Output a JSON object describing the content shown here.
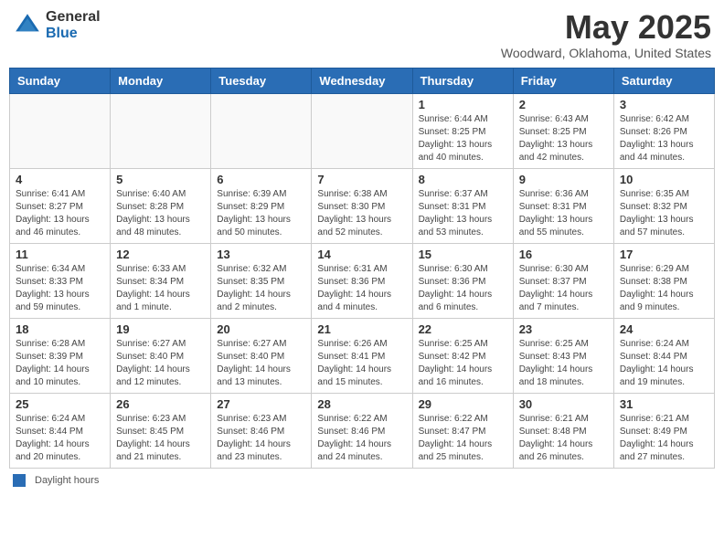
{
  "header": {
    "logo_general": "General",
    "logo_blue": "Blue",
    "month_title": "May 2025",
    "location": "Woodward, Oklahoma, United States"
  },
  "days_of_week": [
    "Sunday",
    "Monday",
    "Tuesday",
    "Wednesday",
    "Thursday",
    "Friday",
    "Saturday"
  ],
  "weeks": [
    [
      {
        "day": "",
        "info": ""
      },
      {
        "day": "",
        "info": ""
      },
      {
        "day": "",
        "info": ""
      },
      {
        "day": "",
        "info": ""
      },
      {
        "day": "1",
        "info": "Sunrise: 6:44 AM\nSunset: 8:25 PM\nDaylight: 13 hours and 40 minutes."
      },
      {
        "day": "2",
        "info": "Sunrise: 6:43 AM\nSunset: 8:25 PM\nDaylight: 13 hours and 42 minutes."
      },
      {
        "day": "3",
        "info": "Sunrise: 6:42 AM\nSunset: 8:26 PM\nDaylight: 13 hours and 44 minutes."
      }
    ],
    [
      {
        "day": "4",
        "info": "Sunrise: 6:41 AM\nSunset: 8:27 PM\nDaylight: 13 hours and 46 minutes."
      },
      {
        "day": "5",
        "info": "Sunrise: 6:40 AM\nSunset: 8:28 PM\nDaylight: 13 hours and 48 minutes."
      },
      {
        "day": "6",
        "info": "Sunrise: 6:39 AM\nSunset: 8:29 PM\nDaylight: 13 hours and 50 minutes."
      },
      {
        "day": "7",
        "info": "Sunrise: 6:38 AM\nSunset: 8:30 PM\nDaylight: 13 hours and 52 minutes."
      },
      {
        "day": "8",
        "info": "Sunrise: 6:37 AM\nSunset: 8:31 PM\nDaylight: 13 hours and 53 minutes."
      },
      {
        "day": "9",
        "info": "Sunrise: 6:36 AM\nSunset: 8:31 PM\nDaylight: 13 hours and 55 minutes."
      },
      {
        "day": "10",
        "info": "Sunrise: 6:35 AM\nSunset: 8:32 PM\nDaylight: 13 hours and 57 minutes."
      }
    ],
    [
      {
        "day": "11",
        "info": "Sunrise: 6:34 AM\nSunset: 8:33 PM\nDaylight: 13 hours and 59 minutes."
      },
      {
        "day": "12",
        "info": "Sunrise: 6:33 AM\nSunset: 8:34 PM\nDaylight: 14 hours and 1 minute."
      },
      {
        "day": "13",
        "info": "Sunrise: 6:32 AM\nSunset: 8:35 PM\nDaylight: 14 hours and 2 minutes."
      },
      {
        "day": "14",
        "info": "Sunrise: 6:31 AM\nSunset: 8:36 PM\nDaylight: 14 hours and 4 minutes."
      },
      {
        "day": "15",
        "info": "Sunrise: 6:30 AM\nSunset: 8:36 PM\nDaylight: 14 hours and 6 minutes."
      },
      {
        "day": "16",
        "info": "Sunrise: 6:30 AM\nSunset: 8:37 PM\nDaylight: 14 hours and 7 minutes."
      },
      {
        "day": "17",
        "info": "Sunrise: 6:29 AM\nSunset: 8:38 PM\nDaylight: 14 hours and 9 minutes."
      }
    ],
    [
      {
        "day": "18",
        "info": "Sunrise: 6:28 AM\nSunset: 8:39 PM\nDaylight: 14 hours and 10 minutes."
      },
      {
        "day": "19",
        "info": "Sunrise: 6:27 AM\nSunset: 8:40 PM\nDaylight: 14 hours and 12 minutes."
      },
      {
        "day": "20",
        "info": "Sunrise: 6:27 AM\nSunset: 8:40 PM\nDaylight: 14 hours and 13 minutes."
      },
      {
        "day": "21",
        "info": "Sunrise: 6:26 AM\nSunset: 8:41 PM\nDaylight: 14 hours and 15 minutes."
      },
      {
        "day": "22",
        "info": "Sunrise: 6:25 AM\nSunset: 8:42 PM\nDaylight: 14 hours and 16 minutes."
      },
      {
        "day": "23",
        "info": "Sunrise: 6:25 AM\nSunset: 8:43 PM\nDaylight: 14 hours and 18 minutes."
      },
      {
        "day": "24",
        "info": "Sunrise: 6:24 AM\nSunset: 8:44 PM\nDaylight: 14 hours and 19 minutes."
      }
    ],
    [
      {
        "day": "25",
        "info": "Sunrise: 6:24 AM\nSunset: 8:44 PM\nDaylight: 14 hours and 20 minutes."
      },
      {
        "day": "26",
        "info": "Sunrise: 6:23 AM\nSunset: 8:45 PM\nDaylight: 14 hours and 21 minutes."
      },
      {
        "day": "27",
        "info": "Sunrise: 6:23 AM\nSunset: 8:46 PM\nDaylight: 14 hours and 23 minutes."
      },
      {
        "day": "28",
        "info": "Sunrise: 6:22 AM\nSunset: 8:46 PM\nDaylight: 14 hours and 24 minutes."
      },
      {
        "day": "29",
        "info": "Sunrise: 6:22 AM\nSunset: 8:47 PM\nDaylight: 14 hours and 25 minutes."
      },
      {
        "day": "30",
        "info": "Sunrise: 6:21 AM\nSunset: 8:48 PM\nDaylight: 14 hours and 26 minutes."
      },
      {
        "day": "31",
        "info": "Sunrise: 6:21 AM\nSunset: 8:49 PM\nDaylight: 14 hours and 27 minutes."
      }
    ]
  ],
  "footer": {
    "legend_label": "Daylight hours"
  }
}
